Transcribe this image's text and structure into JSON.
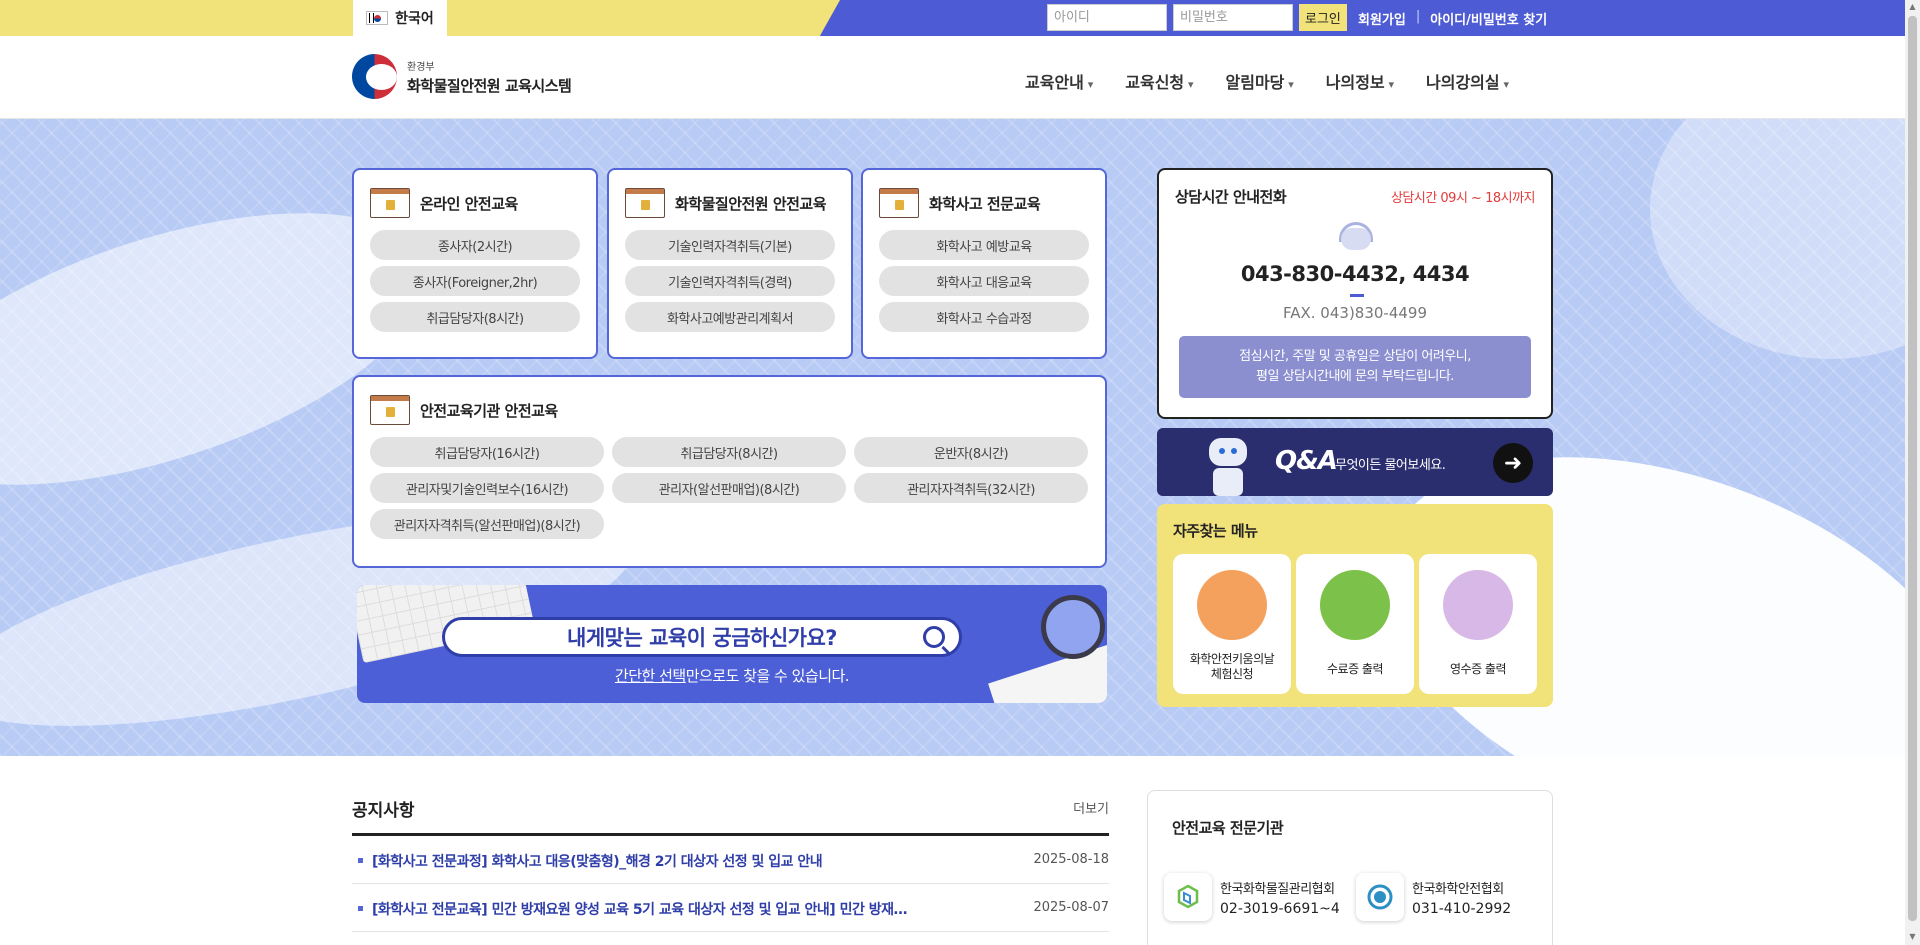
{
  "topbar": {
    "language": "한국어",
    "id_placeholder": "아이디",
    "pw_placeholder": "비밀번호",
    "login_label": "로그인",
    "signup_label": "회원가입",
    "find_label": "아이디/비밀번호 찾기",
    "separator": "|"
  },
  "header": {
    "ministry": "환경부",
    "site_title": "화학물질안전원 교육시스템",
    "nav": [
      "교육안내",
      "교육신청",
      "알림마당",
      "나의정보",
      "나의강의실"
    ]
  },
  "cards": {
    "online": {
      "title": "온라인 안전교육",
      "items": [
        "종사자(2시간)",
        "종사자(Foreigner,2hr)",
        "취급담당자(8시간)"
      ]
    },
    "institute": {
      "title": "화학물질안전원 안전교육",
      "items": [
        "기술인력자격취득(기본)",
        "기술인력자격취득(경력)",
        "화학사고예방관리계획서"
      ]
    },
    "accident": {
      "title": "화학사고 전문교육",
      "items": [
        "화학사고 예방교육",
        "화학사고 대응교육",
        "화학사고 수습과정"
      ]
    },
    "agency": {
      "title": "안전교육기관 안전교육",
      "items": [
        "취급담당자(16시간)",
        "취급담당자(8시간)",
        "운반자(8시간)",
        "관리자및기술인력보수(16시간)",
        "관리자(알선판매업)(8시간)",
        "관리자자격취득(32시간)",
        "관리자자격취득(알선판매업)(8시간)"
      ]
    }
  },
  "search_banner": {
    "title": "내게맞는 교육이 궁금하신가요?",
    "sub_underlined": "간단한 선택",
    "sub_rest": "만으로도 찾을 수 있습니다."
  },
  "consult": {
    "title": "상담시간 안내전화",
    "time": "상담시간 09시 ~ 18시까지",
    "phone": "043-830-4432, 4434",
    "fax": "FAX. 043)830-4499",
    "note_line1": "점심시간, 주말 및 공휴일은 상담이 어려우니,",
    "note_line2": "평일 상담시간내에 문의 부탁드립니다."
  },
  "qna": {
    "title": "Q&A",
    "sub": "무엇이든 물어보세요.",
    "arrow": "➜"
  },
  "frequent": {
    "title": "자주찾는 메뉴",
    "items": [
      {
        "line1": "화학안전키움의날",
        "line2": "체험신청",
        "color": "#f5a15e"
      },
      {
        "line1": "수료증 출력",
        "line2": "",
        "color": "#7cc24a"
      },
      {
        "line1": "영수증 출력",
        "line2": "",
        "color": "#d7b8e6"
      }
    ]
  },
  "notice": {
    "title": "공지사항",
    "more": "더보기",
    "rows": [
      {
        "text": "[화학사고 전문과정] 화학사고 대응(맞춤형)_해경 2기 대상자 선정 및 입교 안내",
        "date": "2025-08-18"
      },
      {
        "text": "[화학사고 전문교육] 민간 방재요원 양성 교육 5기 교육 대상자 선정 및 입교 안내] 민간 방재…",
        "date": "2025-08-07"
      }
    ]
  },
  "orgs": {
    "title": "안전교육 전문기관",
    "items": [
      {
        "name": "한국화학물질관리협회",
        "phone": "02-3019-6691~4"
      },
      {
        "name": "한국화학안전협회",
        "phone": "031-410-2992"
      }
    ]
  },
  "colors": {
    "primary": "#4d5bd4",
    "accent_yellow": "#f2e27a",
    "hero_bg": "#b8cbf5",
    "alert_red": "#e23b3b"
  }
}
